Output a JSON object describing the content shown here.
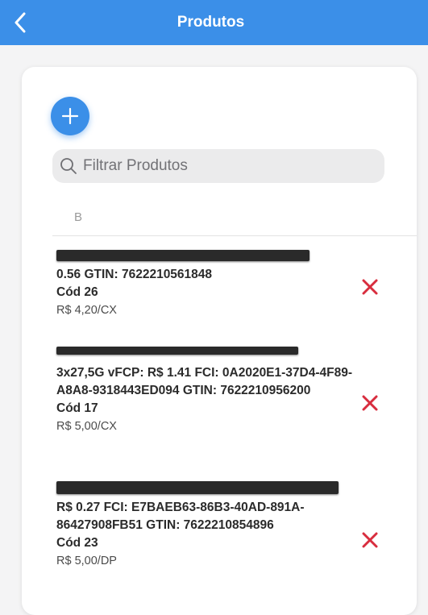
{
  "header": {
    "title": "Produtos",
    "back_icon": "chevron-left-icon",
    "background": "#3b8fe8"
  },
  "add_button": {
    "icon": "plus-icon",
    "color": "#3b8fe8"
  },
  "search": {
    "placeholder": "Filtrar Produtos",
    "icon": "search-icon"
  },
  "section": {
    "letter": "B"
  },
  "products": [
    {
      "description": "0.56 GTIN: 7622210561848",
      "code": "Cód 26",
      "price": "R$ 4,20/CX"
    },
    {
      "description": "3x27,5G vFCP: R$ 1.41 FCI: 0A2020E1-37D4-4F89-A8A8-9318443ED094 GTIN: 7622210956200",
      "code": "Cód 17",
      "price": "R$ 5,00/CX"
    },
    {
      "description": "R$ 0.27 FCI: E7BAEB63-86B3-40AD-891A-86427908FB51 GTIN: 7622210854896",
      "code": "Cód 23",
      "price": "R$ 5,00/DP"
    }
  ],
  "colors": {
    "delete": "#d82d3e",
    "accent": "#3b8fe8"
  }
}
